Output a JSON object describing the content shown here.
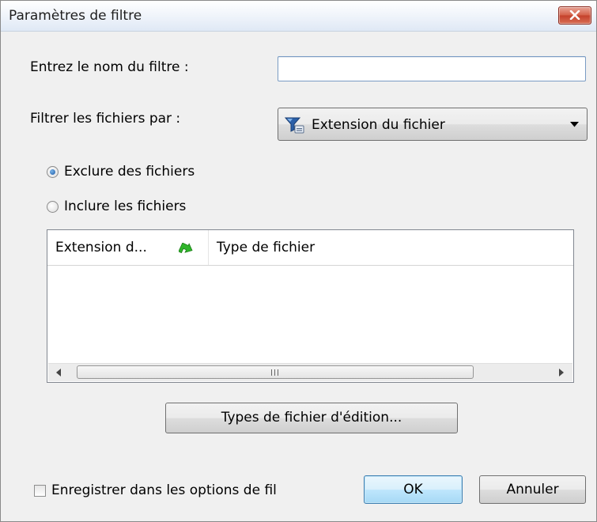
{
  "dialog": {
    "title": "Paramètres de filtre",
    "close_icon": "close-icon"
  },
  "filter_name": {
    "label": "Entrez le nom du filtre :",
    "value": ""
  },
  "filter_by": {
    "label": "Filtrer les fichiers par :",
    "selected": "Extension du fichier",
    "icon": "filter-funnel-icon"
  },
  "mode": {
    "exclude_label": "Exclure des fichiers",
    "include_label": "Inclure les fichiers",
    "selected": "exclude"
  },
  "list": {
    "columns": [
      "Extension d...",
      "Type de fichier"
    ],
    "sort_icon": "sort-arrow-icon",
    "rows": [],
    "scroll_grip": "III"
  },
  "buttons": {
    "edit_types": "Types de fichier d'édition...",
    "ok": "OK",
    "cancel": "Annuler"
  },
  "save_option": {
    "label": "Enregistrer dans les options de fil",
    "checked": false
  },
  "colors": {
    "title_bg": "#dfe8f5",
    "close_red": "#c4402a",
    "default_button": "#bee6fd",
    "sort_arrow": "#2fb52a"
  }
}
